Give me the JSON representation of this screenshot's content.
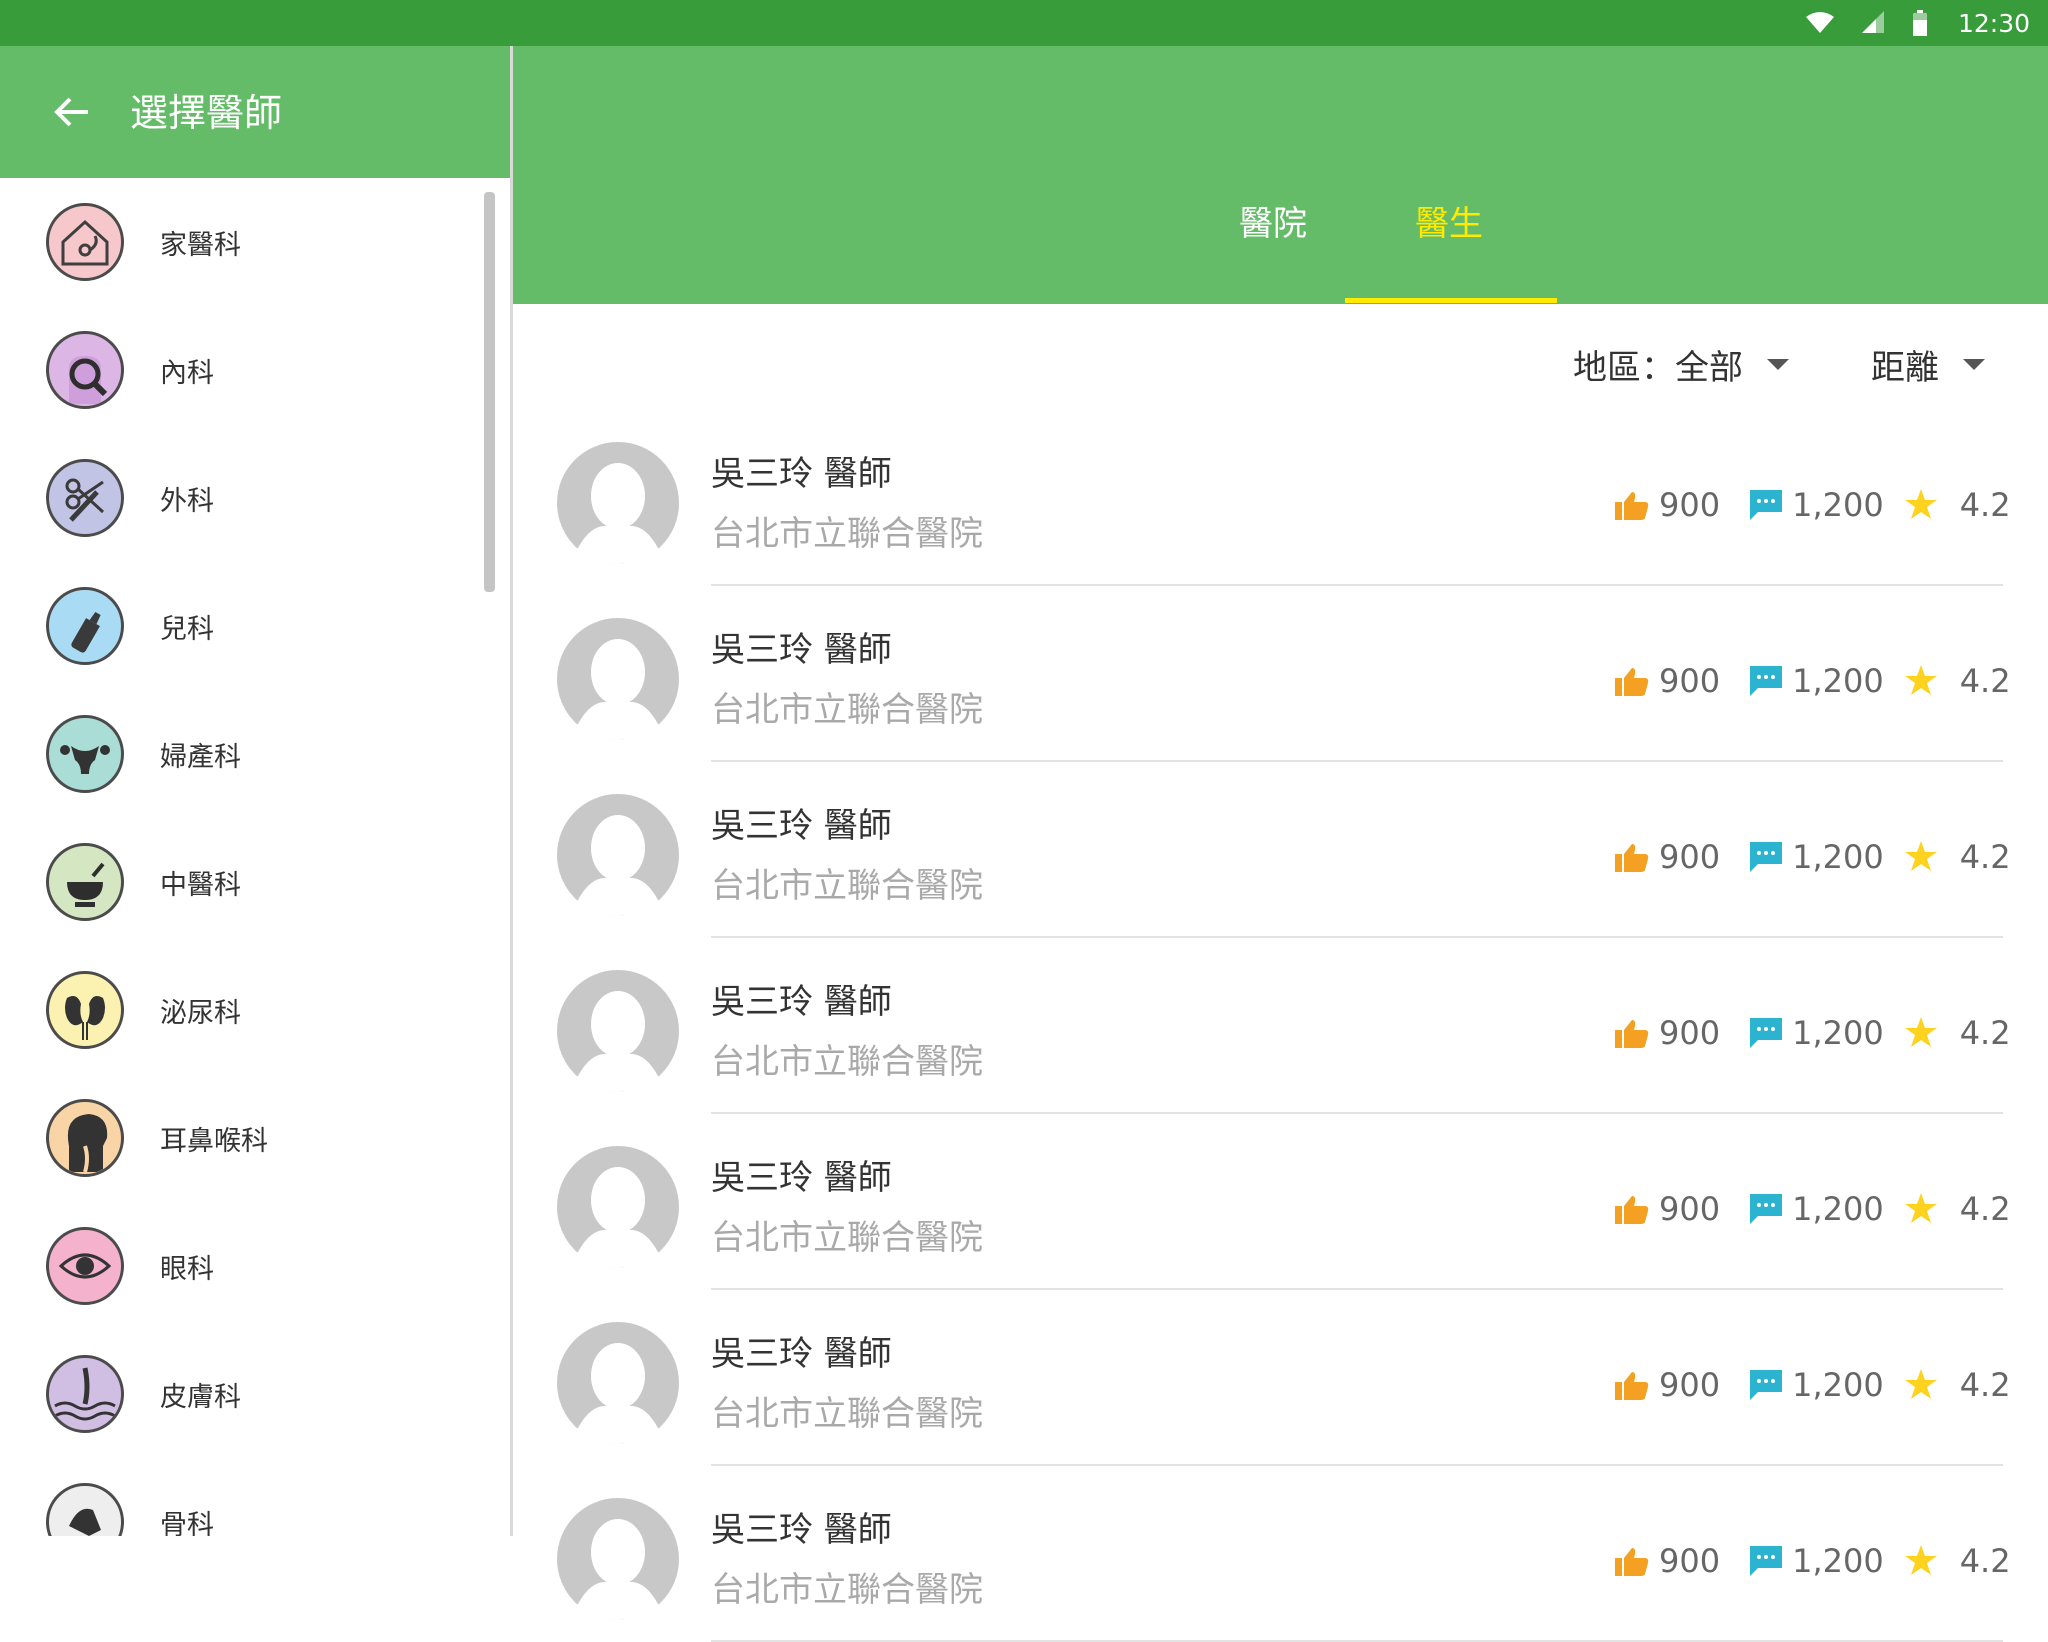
{
  "status_bar": {
    "time": "12:30"
  },
  "drawer": {
    "title": "選擇醫師",
    "departments": [
      {
        "label": "家醫科",
        "icon": "house-stethoscope-icon",
        "color": "#f6c7cb"
      },
      {
        "label": "內科",
        "icon": "body-magnifier-icon",
        "color": "#dcb6e5"
      },
      {
        "label": "外科",
        "icon": "scissors-scalpel-icon",
        "color": "#c2c4e6"
      },
      {
        "label": "兒科",
        "icon": "baby-bottle-icon",
        "color": "#a9dcf4"
      },
      {
        "label": "婦產科",
        "icon": "uterus-icon",
        "color": "#a9ddd6"
      },
      {
        "label": "中醫科",
        "icon": "mortar-pestle-icon",
        "color": "#d5e7c2"
      },
      {
        "label": "泌尿科",
        "icon": "kidneys-icon",
        "color": "#fbf1b1"
      },
      {
        "label": "耳鼻喉科",
        "icon": "head-throat-icon",
        "color": "#f8d4a6"
      },
      {
        "label": "眼科",
        "icon": "eye-icon",
        "color": "#f4b2cd"
      },
      {
        "label": "皮膚科",
        "icon": "skin-hair-icon",
        "color": "#d0bfe3"
      },
      {
        "label": "骨科",
        "icon": "bone-joint-icon",
        "color": "#eeeeee"
      }
    ]
  },
  "tabs": {
    "hospital": "醫院",
    "doctor": "醫生"
  },
  "filters": {
    "region": "地區：全部",
    "distance": "距離"
  },
  "doctors": [
    {
      "name": "吳三玲 醫師",
      "hospital": "台北市立聯合醫院",
      "likes": "900",
      "comments": "1,200",
      "rating": "4.2"
    },
    {
      "name": "吳三玲 醫師",
      "hospital": "台北市立聯合醫院",
      "likes": "900",
      "comments": "1,200",
      "rating": "4.2"
    },
    {
      "name": "吳三玲 醫師",
      "hospital": "台北市立聯合醫院",
      "likes": "900",
      "comments": "1,200",
      "rating": "4.2"
    },
    {
      "name": "吳三玲 醫師",
      "hospital": "台北市立聯合醫院",
      "likes": "900",
      "comments": "1,200",
      "rating": "4.2"
    },
    {
      "name": "吳三玲 醫師",
      "hospital": "台北市立聯合醫院",
      "likes": "900",
      "comments": "1,200",
      "rating": "4.2"
    },
    {
      "name": "吳三玲 醫師",
      "hospital": "台北市立聯合醫院",
      "likes": "900",
      "comments": "1,200",
      "rating": "4.2"
    },
    {
      "name": "吳三玲 醫師",
      "hospital": "台北市立聯合醫院",
      "likes": "900",
      "comments": "1,200",
      "rating": "4.2"
    }
  ],
  "colors": {
    "status_bar": "#399c3b",
    "primary": "#64bb68",
    "tab_active": "#ffea00",
    "like": "#f4a123",
    "comment": "#2bb3cf",
    "star": "#ffd21f"
  }
}
